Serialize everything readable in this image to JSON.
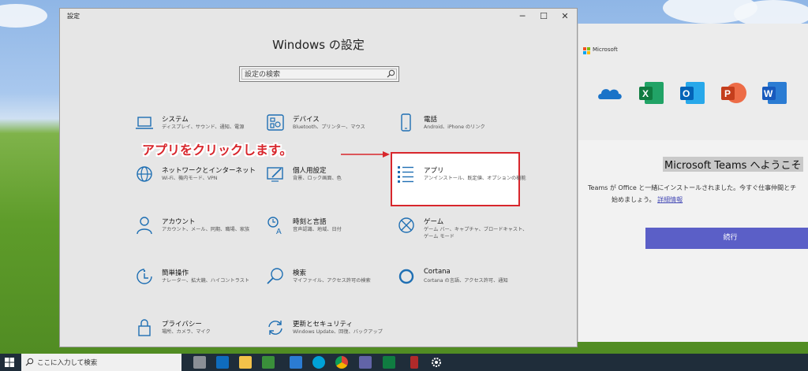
{
  "settings": {
    "window_title": "設定",
    "controls": {
      "minimize": "─",
      "maximize": "☐",
      "close": "✕"
    },
    "heading": "Windows の設定",
    "search_placeholder": "設定の検索",
    "tiles": [
      {
        "name": "システム",
        "desc": "ディスプレイ、サウンド、通知、電源",
        "icon": "laptop-icon"
      },
      {
        "name": "デバイス",
        "desc": "Bluetooth、プリンター、マウス",
        "icon": "devices-icon"
      },
      {
        "name": "電話",
        "desc": "Android、iPhone のリンク",
        "icon": "phone-icon"
      },
      {
        "name": "ネットワークとインターネット",
        "desc": "Wi-Fi、機内モード、VPN",
        "icon": "globe-icon"
      },
      {
        "name": "個人用設定",
        "desc": "背景、ロック画面、色",
        "icon": "personalization-icon"
      },
      {
        "name": "アプリ",
        "desc": "アンインストール、既定値、オプションの機能",
        "icon": "apps-list-icon"
      },
      {
        "name": "アカウント",
        "desc": "アカウント、メール、同期、職場、家族",
        "icon": "person-icon"
      },
      {
        "name": "時刻と言語",
        "desc": "音声認識、地域、日付",
        "icon": "time-language-icon"
      },
      {
        "name": "ゲーム",
        "desc": "ゲーム バー、キャプチャ、ブロードキャスト、ゲーム モード",
        "icon": "xbox-icon"
      },
      {
        "name": "簡単操作",
        "desc": "ナレーター、拡大鏡、ハイコントラスト",
        "icon": "ease-of-access-icon"
      },
      {
        "name": "検索",
        "desc": "マイファイル、アクセス許可の検索",
        "icon": "search-icon"
      },
      {
        "name": "Cortana",
        "desc": "Cortana の言語、アクセス許可、通知",
        "icon": "cortana-icon"
      },
      {
        "name": "プライバシー",
        "desc": "場所、カメラ、マイク",
        "icon": "lock-icon"
      },
      {
        "name": "更新とセキュリティ",
        "desc": "Windows Update、回復、バックアップ",
        "icon": "update-icon"
      }
    ]
  },
  "annotation": {
    "callout": "アプリをクリックします。",
    "color": "#d8262c"
  },
  "teams": {
    "brand": "Microsoft",
    "welcome": "Microsoft Teams へようこそ",
    "desc_line1": "Teams が Office と一緒にインストールされました。今すぐ仕事仲間とチ",
    "desc_line2_prefix": "始めましょう。",
    "desc_link": "詳細情報",
    "continue_label": "続行",
    "apps": [
      "onedrive-icon",
      "excel-icon",
      "outlook-icon",
      "powerpoint-icon",
      "word-icon"
    ],
    "accent": "#5b5fc7"
  },
  "taskbar": {
    "search_placeholder": "ここに入力して検索",
    "icons": [
      "task-view-icon",
      "outlook-icon",
      "file-explorer-icon",
      "maps-icon",
      "word-icon",
      "media-player-icon",
      "chrome-icon",
      "teams-icon",
      "excel-icon",
      "phone-link-icon",
      "settings-gear-icon"
    ]
  }
}
